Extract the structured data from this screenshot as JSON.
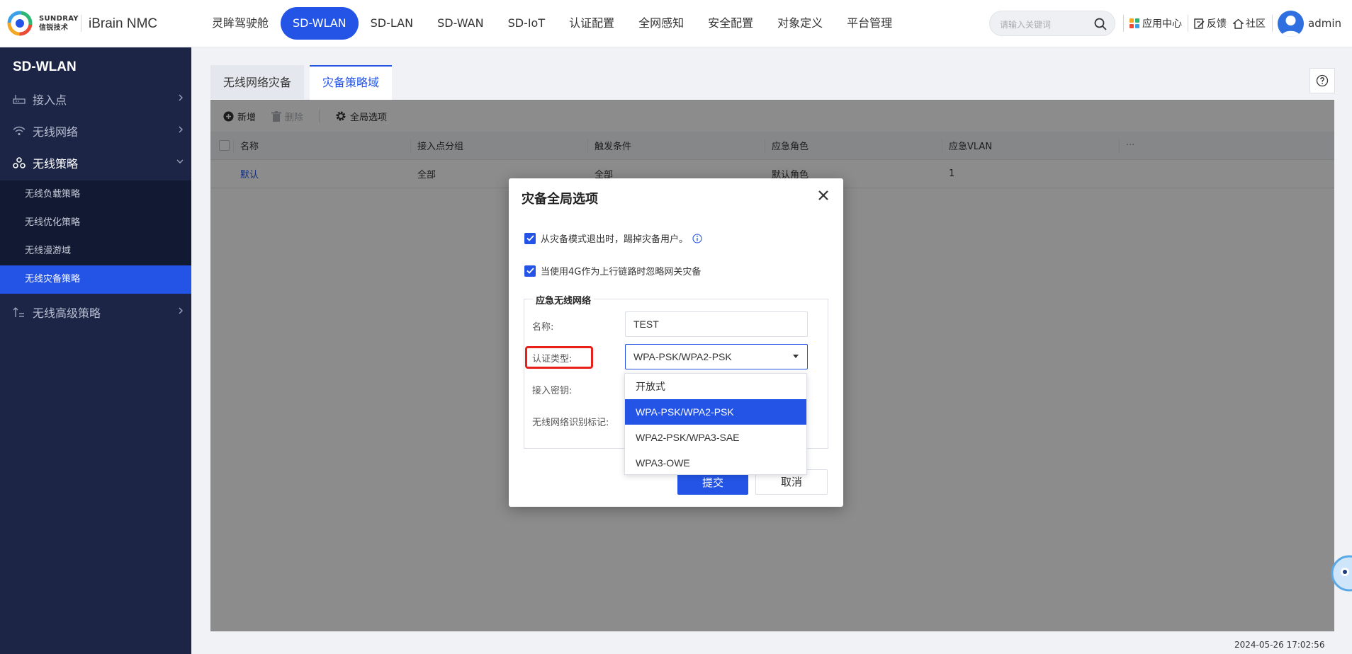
{
  "brand": {
    "line1": "SUNDRAY",
    "line2": "信锐技术",
    "app_name": "iBrain NMC"
  },
  "nav": [
    {
      "label": "灵眸驾驶舱",
      "active": false
    },
    {
      "label": "SD-WLAN",
      "active": true
    },
    {
      "label": "SD-LAN",
      "active": false
    },
    {
      "label": "SD-WAN",
      "active": false
    },
    {
      "label": "SD-IoT",
      "active": false
    },
    {
      "label": "认证配置",
      "active": false
    },
    {
      "label": "全网感知",
      "active": false
    },
    {
      "label": "安全配置",
      "active": false
    },
    {
      "label": "对象定义",
      "active": false
    },
    {
      "label": "平台管理",
      "active": false
    }
  ],
  "search": {
    "placeholder": "请输入关键词"
  },
  "header_tools": {
    "app_center": "应用中心",
    "feedback": "反馈",
    "community": "社区",
    "user": "admin"
  },
  "sidebar": {
    "title": "SD-WLAN",
    "items": [
      {
        "label": "接入点",
        "icon": "router-icon"
      },
      {
        "label": "无线网络",
        "icon": "wifi-icon"
      },
      {
        "label": "无线策略",
        "icon": "strategy-icon"
      },
      {
        "label": "无线高级策略",
        "icon": "advanced-icon"
      }
    ],
    "sub_items": [
      {
        "label": "无线负载策略"
      },
      {
        "label": "无线优化策略"
      },
      {
        "label": "无线漫游域"
      },
      {
        "label": "无线灾备策略",
        "active": true
      }
    ]
  },
  "tabs": [
    {
      "label": "无线网络灾备",
      "active": false
    },
    {
      "label": "灾备策略域",
      "active": true
    }
  ],
  "toolbar": {
    "add": "新增",
    "delete": "删除",
    "global_options": "全局选项"
  },
  "table": {
    "headers": [
      "名称",
      "接入点分组",
      "触发条件",
      "应急角色",
      "应急VLAN"
    ],
    "more": "···",
    "rows": [
      [
        "默认",
        "全部",
        "全部",
        "默认角色",
        "1"
      ]
    ]
  },
  "dialog": {
    "title": "灾备全局选项",
    "check1": "从灾备模式退出时，踢掉灾备用户。",
    "check2": "当使用4G作为上行链路时忽略网关灾备",
    "section": "应急无线网络",
    "name_label": "名称:",
    "name_value": "TEST",
    "auth_label": "认证类型:",
    "auth_value": "WPA-PSK/WPA2-PSK",
    "key_label": "接入密钥:",
    "ssid_label": "无线网络识别标记:",
    "auth_options": [
      "开放式",
      "WPA-PSK/WPA2-PSK",
      "WPA2-PSK/WPA3-SAE",
      "WPA3-OWE"
    ],
    "selected_index": 1,
    "submit": "提交",
    "cancel": "取消"
  },
  "timestamp": "2024-05-26 17:02:56",
  "colors": {
    "accent": "#2354e6",
    "sidebar_bg": "#1c2545",
    "highlight": "#e8201a"
  }
}
